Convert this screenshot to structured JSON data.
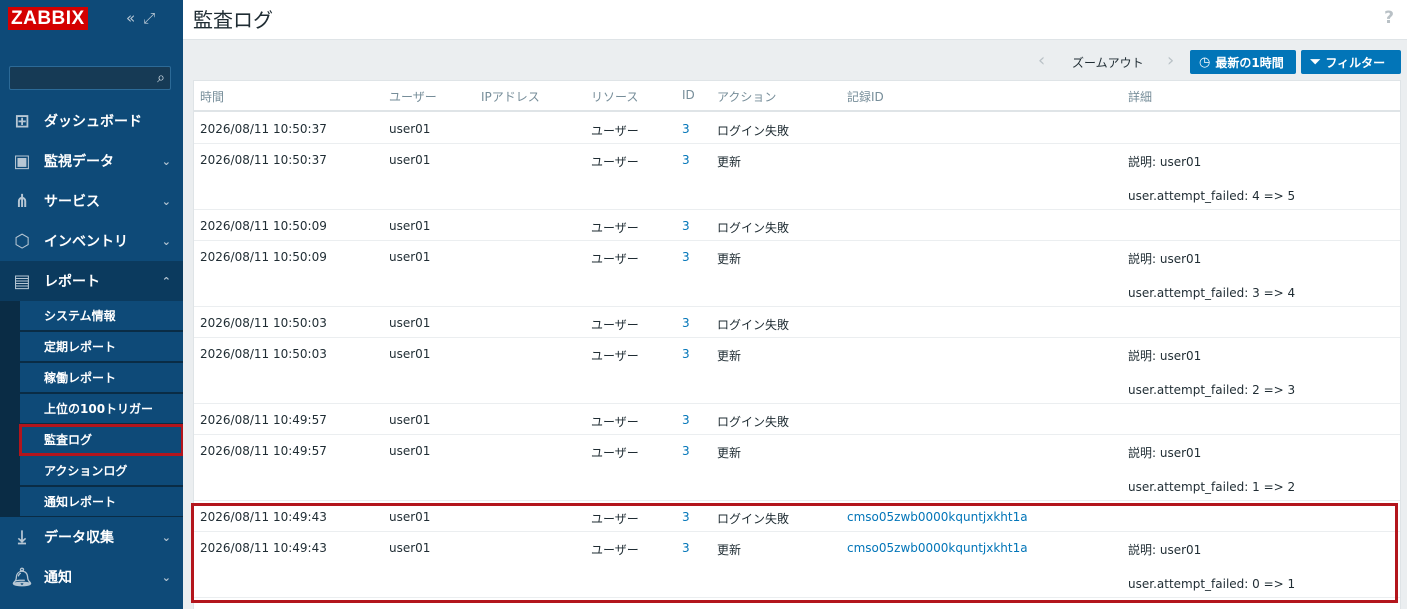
{
  "brand": {
    "logo_text": "ZABBIX",
    "accent": "#d40000"
  },
  "sidebar": {
    "menu": [
      {
        "label": "ダッシュボード",
        "icon": "dashboard-icon"
      },
      {
        "label": "監視データ",
        "icon": "monitoring-icon"
      },
      {
        "label": "サービス",
        "icon": "services-icon"
      },
      {
        "label": "インベントリ",
        "icon": "inventory-icon"
      },
      {
        "label": "レポート",
        "icon": "reports-icon"
      },
      {
        "label": "データ収集",
        "icon": "data-collection-icon"
      },
      {
        "label": "通知",
        "icon": "alerts-icon"
      }
    ],
    "submenu": [
      {
        "label": "システム情報"
      },
      {
        "label": "定期レポート"
      },
      {
        "label": "稼働レポート"
      },
      {
        "label": "上位の100トリガー"
      },
      {
        "label": "監査ログ"
      },
      {
        "label": "アクションログ"
      },
      {
        "label": "通知レポート"
      }
    ]
  },
  "header": {
    "title": "監査ログ",
    "help": "?"
  },
  "toolbar": {
    "zoom_out": "ズームアウト",
    "time_range_button": "最新の1時間",
    "filter_button": "フィルター"
  },
  "table": {
    "columns": [
      "時間",
      "ユーザー",
      "IPアドレス",
      "リソース",
      "ID",
      "アクション",
      "記録ID",
      "詳細"
    ],
    "rows": [
      {
        "time": "2026/08/11 10:50:37",
        "user": "user01",
        "ip": "",
        "resource": "ユーザー",
        "id": "3",
        "action": "ログイン失敗",
        "record_id": "",
        "details": []
      },
      {
        "time": "2026/08/11 10:50:37",
        "user": "user01",
        "ip": "",
        "resource": "ユーザー",
        "id": "3",
        "action": "更新",
        "record_id": "",
        "details": [
          "説明: user01",
          "user.attempt_failed: 4 => 5"
        ]
      },
      {
        "time": "2026/08/11 10:50:09",
        "user": "user01",
        "ip": "",
        "resource": "ユーザー",
        "id": "3",
        "action": "ログイン失敗",
        "record_id": "",
        "details": []
      },
      {
        "time": "2026/08/11 10:50:09",
        "user": "user01",
        "ip": "",
        "resource": "ユーザー",
        "id": "3",
        "action": "更新",
        "record_id": "",
        "details": [
          "説明: user01",
          "user.attempt_failed: 3 => 4"
        ]
      },
      {
        "time": "2026/08/11 10:50:03",
        "user": "user01",
        "ip": "",
        "resource": "ユーザー",
        "id": "3",
        "action": "ログイン失敗",
        "record_id": "",
        "details": []
      },
      {
        "time": "2026/08/11 10:50:03",
        "user": "user01",
        "ip": "",
        "resource": "ユーザー",
        "id": "3",
        "action": "更新",
        "record_id": "",
        "details": [
          "説明: user01",
          "user.attempt_failed: 2 => 3"
        ]
      },
      {
        "time": "2026/08/11 10:49:57",
        "user": "user01",
        "ip": "",
        "resource": "ユーザー",
        "id": "3",
        "action": "ログイン失敗",
        "record_id": "",
        "details": []
      },
      {
        "time": "2026/08/11 10:49:57",
        "user": "user01",
        "ip": "",
        "resource": "ユーザー",
        "id": "3",
        "action": "更新",
        "record_id": "",
        "details": [
          "説明: user01",
          "user.attempt_failed: 1 => 2"
        ]
      },
      {
        "time": "2026/08/11 10:49:43",
        "user": "user01",
        "ip": "",
        "resource": "ユーザー",
        "id": "3",
        "action": "ログイン失敗",
        "record_id": "cmso05zwb0000kquntjxkht1a",
        "details": []
      },
      {
        "time": "2026/08/11 10:49:43",
        "user": "user01",
        "ip": "",
        "resource": "ユーザー",
        "id": "3",
        "action": "更新",
        "record_id": "cmso05zwb0000kquntjxkht1a",
        "details": [
          "説明: user01",
          "user.attempt_failed: 0 => 1"
        ]
      }
    ]
  }
}
